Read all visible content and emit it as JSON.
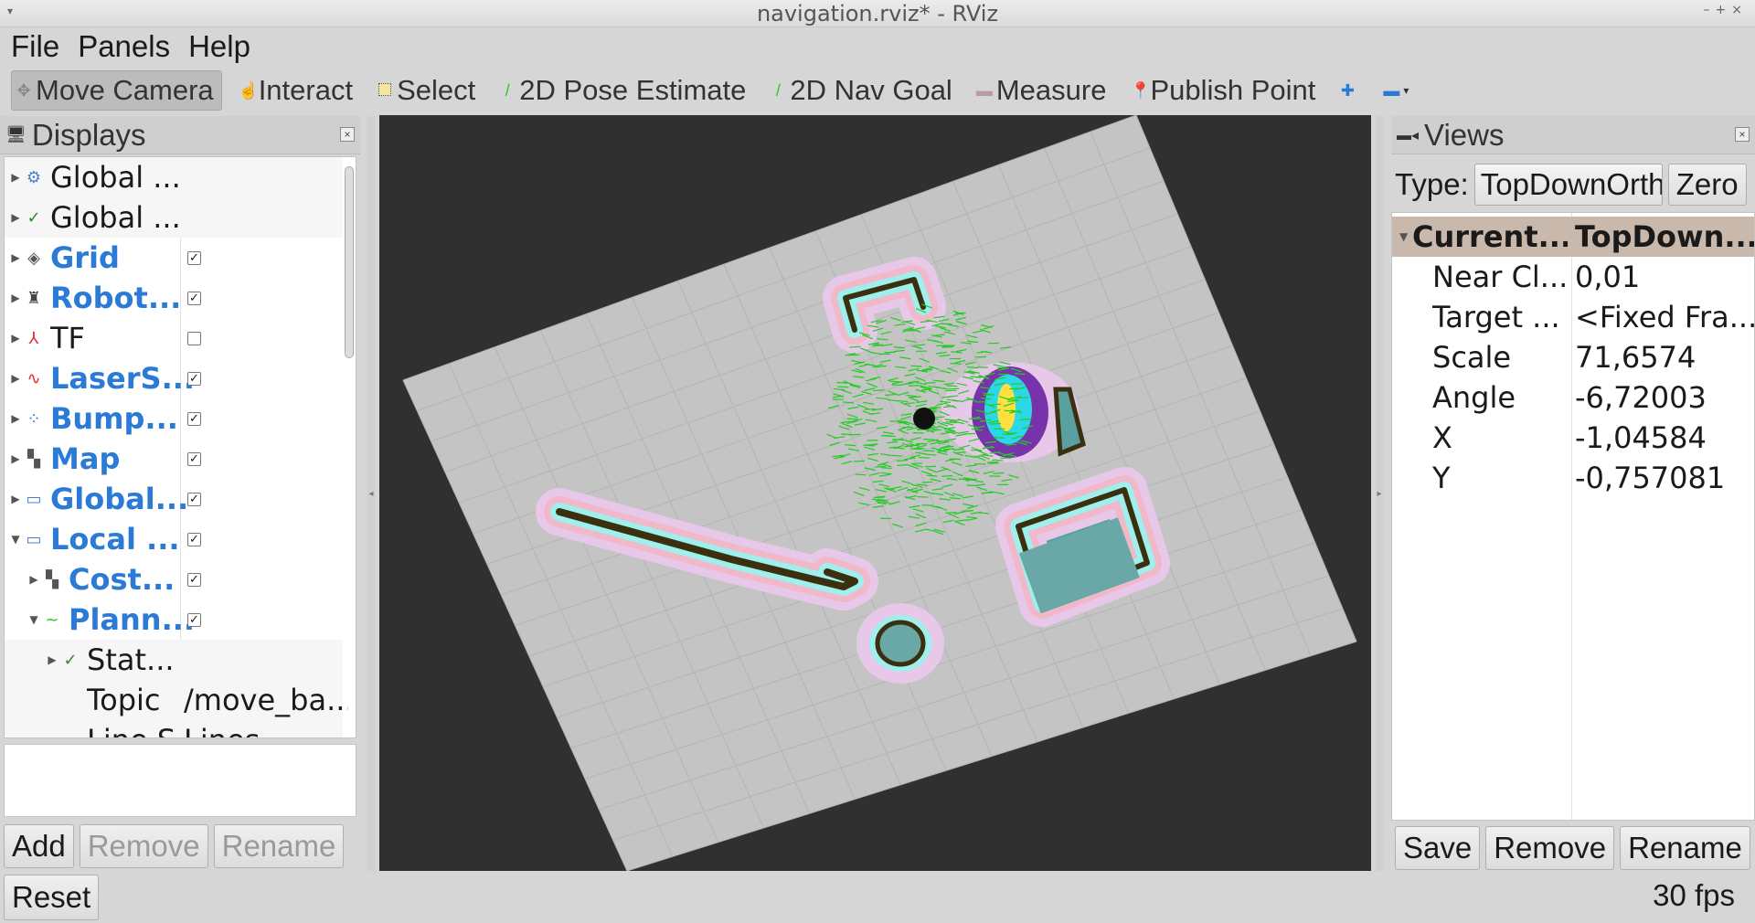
{
  "window": {
    "title": "navigation.rviz* - RViz"
  },
  "menu": [
    "File",
    "Panels",
    "Help"
  ],
  "toolbar": [
    {
      "label": "Move Camera",
      "icon": "move-camera-icon",
      "active": true
    },
    {
      "label": "Interact",
      "icon": "hand-icon"
    },
    {
      "label": "Select",
      "icon": "select-icon"
    },
    {
      "label": "2D Pose Estimate",
      "icon": "green-arrow-icon"
    },
    {
      "label": "2D Nav Goal",
      "icon": "green-arrow-icon"
    },
    {
      "label": "Measure",
      "icon": "ruler-icon"
    },
    {
      "label": "Publish Point",
      "icon": "pin-icon"
    }
  ],
  "displays": {
    "title": "Displays",
    "items": [
      {
        "name": "Global ...",
        "icon": "gear-icon",
        "arrow": "right",
        "level": 0,
        "checked": null
      },
      {
        "name": "Global ...",
        "icon": "check-icon",
        "arrow": "right",
        "level": 0,
        "checked": null
      },
      {
        "name": "Grid",
        "icon": "grid-icon",
        "arrow": "right",
        "level": 0,
        "checked": true,
        "blue": true
      },
      {
        "name": "Robot...",
        "icon": "robot-icon",
        "arrow": "right",
        "level": 0,
        "checked": true,
        "blue": true
      },
      {
        "name": "TF",
        "icon": "axes-icon",
        "arrow": "right",
        "level": 0,
        "checked": false
      },
      {
        "name": "LaserS...",
        "icon": "laser-icon",
        "arrow": "right",
        "level": 0,
        "checked": true,
        "blue": true
      },
      {
        "name": "Bump...",
        "icon": "pointcloud-icon",
        "arrow": "right",
        "level": 0,
        "checked": true,
        "blue": true
      },
      {
        "name": "Map",
        "icon": "map-icon",
        "arrow": "right",
        "level": 0,
        "checked": true,
        "blue": true
      },
      {
        "name": "Global...",
        "icon": "folder-icon",
        "arrow": "right",
        "level": 0,
        "checked": true,
        "blue": true
      },
      {
        "name": "Local ...",
        "icon": "folder-icon",
        "arrow": "down",
        "level": 0,
        "checked": true,
        "blue": true
      },
      {
        "name": "Cost...",
        "icon": "map-icon",
        "arrow": "right",
        "level": 1,
        "checked": true,
        "blue": true
      },
      {
        "name": "Plann...",
        "icon": "path-icon",
        "arrow": "down",
        "level": 1,
        "checked": true,
        "blue": true
      },
      {
        "name": "Stat...",
        "icon": "check-icon",
        "arrow": "right",
        "level": 2,
        "checked": null
      },
      {
        "name": "Topic",
        "value": "/move_ba...",
        "level": 2
      },
      {
        "name": "Line S...",
        "value": "Lines",
        "level": 2
      }
    ],
    "buttons": {
      "add": "Add",
      "remove": "Remove",
      "rename": "Rename"
    }
  },
  "views": {
    "title": "Views",
    "type_label": "Type:",
    "type_value": "TopDownOrtho",
    "zero": "Zero",
    "header": {
      "key": "Current...",
      "value": "TopDown..."
    },
    "properties": [
      {
        "key": "Near Cl...",
        "value": "0,01"
      },
      {
        "key": "Target ...",
        "value": "<Fixed Fra..."
      },
      {
        "key": "Scale",
        "value": "71,6574"
      },
      {
        "key": "Angle",
        "value": "-6,72003"
      },
      {
        "key": "X",
        "value": "-1,04584"
      },
      {
        "key": "Y",
        "value": "-0,757081"
      }
    ],
    "buttons": {
      "save": "Save",
      "remove": "Remove",
      "rename": "Rename"
    }
  },
  "status": {
    "reset": "Reset",
    "fps": "30 fps"
  },
  "colors": {
    "accent_blue": "#2b7bd6",
    "map_floor": "#c4c4c4",
    "viewport_bg": "#303030",
    "inflation_cyan": "#9ff0ec",
    "path_green": "#22cc22"
  }
}
